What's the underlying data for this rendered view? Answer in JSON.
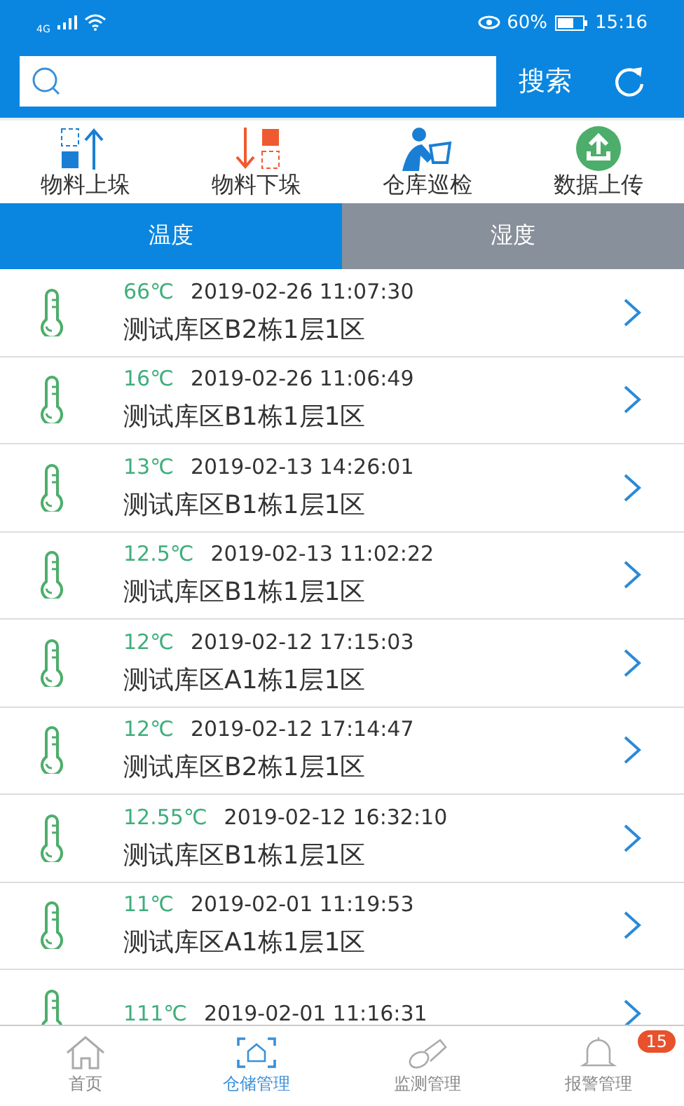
{
  "status_bar": {
    "network": "4G",
    "battery": "60%",
    "time": "15:16"
  },
  "search": {
    "button": "搜索"
  },
  "actions": [
    {
      "kind": "up",
      "label": "物料上垛"
    },
    {
      "kind": "down",
      "label": "物料下垛"
    },
    {
      "kind": "inspect",
      "label": "仓库巡检"
    },
    {
      "kind": "upload",
      "label": "数据上传"
    }
  ],
  "tabs": [
    {
      "label": "温度",
      "selected": true
    },
    {
      "label": "湿度",
      "selected": false
    }
  ],
  "records": [
    {
      "temperature": "66℃",
      "time": "2019-02-26 11:07:30",
      "location": "测试库区B2栋1层1区"
    },
    {
      "temperature": "16℃",
      "time": "2019-02-26 11:06:49",
      "location": "测试库区B1栋1层1区"
    },
    {
      "temperature": "13℃",
      "time": "2019-02-13 14:26:01",
      "location": "测试库区B1栋1层1区"
    },
    {
      "temperature": "12.5℃",
      "time": "2019-02-13 11:02:22",
      "location": "测试库区B1栋1层1区"
    },
    {
      "temperature": "12℃",
      "time": "2019-02-12 17:15:03",
      "location": "测试库区A1栋1层1区"
    },
    {
      "temperature": "12℃",
      "time": "2019-02-12 17:14:47",
      "location": "测试库区B2栋1层1区"
    },
    {
      "temperature": "12.55℃",
      "time": "2019-02-12 16:32:10",
      "location": "测试库区B1栋1层1区"
    },
    {
      "temperature": "11℃",
      "time": "2019-02-01 11:19:53",
      "location": "测试库区A1栋1层1区"
    },
    {
      "temperature": "111℃",
      "time": "2019-02-01 11:16:31"
    }
  ],
  "nav": [
    {
      "kind": "home",
      "label": "首页",
      "selected": false
    },
    {
      "kind": "storage",
      "label": "仓储管理",
      "selected": true
    },
    {
      "kind": "monitor",
      "label": "监测管理",
      "selected": false
    },
    {
      "kind": "alarm",
      "label": "报警管理",
      "selected": false,
      "badge": "15"
    }
  ]
}
